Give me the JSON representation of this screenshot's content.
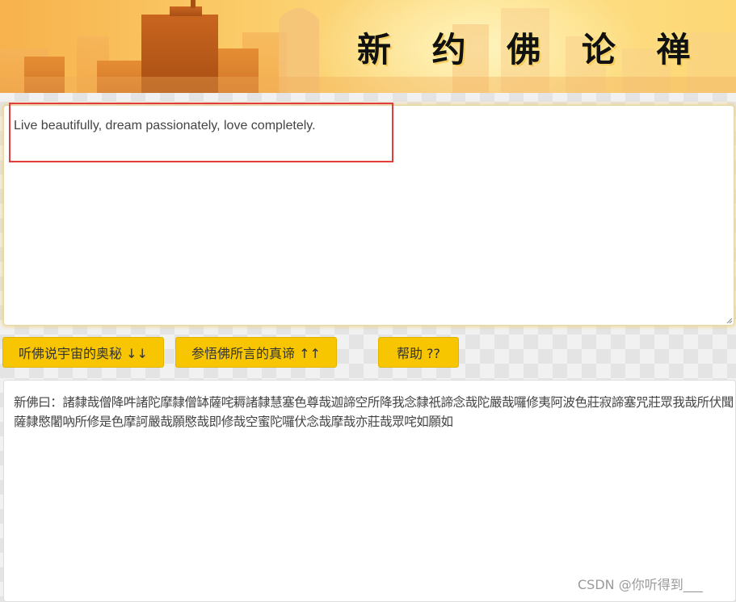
{
  "header": {
    "title": "新 约 佛 论 禅"
  },
  "input": {
    "value": "Live beautifully, dream passionately, love completely."
  },
  "buttons": {
    "decode_label": "听佛说宇宙的奥秘 ↓↓",
    "encode_label": "参悟佛所言的真谛 ↑↑",
    "help_label": "帮助 ??"
  },
  "output": {
    "value": "新佛曰：諸隸哉僧降吽諸陀摩隸僧缽薩咤耨諸隸慧塞色尊哉迦諦空所降我念隸祇諦念哉陀嚴哉囉修夷阿波色莊寂諦塞咒莊眾我哉所伏聞薩隸愍闍吶所修是色摩訶嚴哉願愍哉即修哉空蜜陀囉伏念哉摩哉亦莊哉眾咤如願如"
  },
  "watermark": {
    "text": "CSDN @你听得到___"
  },
  "colors": {
    "button_bg": "#f7c600",
    "highlight": "#e43b3b",
    "banner_orange": "#f7b24c",
    "banner_yellow": "#fde08a"
  }
}
